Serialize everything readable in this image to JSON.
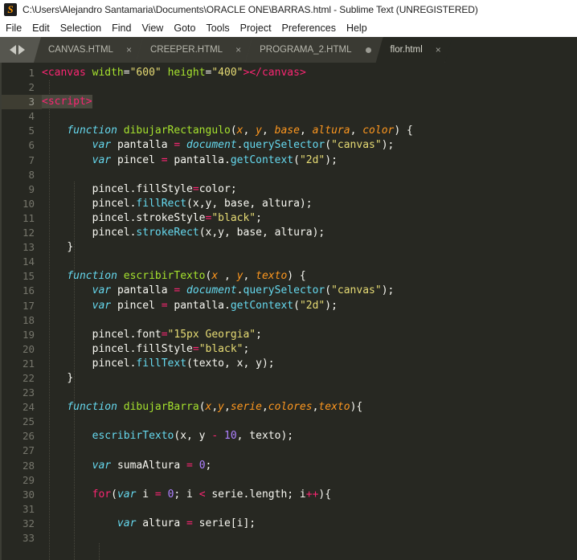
{
  "window": {
    "title": "C:\\Users\\Alejandro Santamaria\\Documents\\ORACLE ONE\\BARRAS.html - Sublime Text (UNREGISTERED)",
    "logo_glyph": "S",
    "logo_icon_name": "sublime-text-logo-icon"
  },
  "menubar": {
    "items": [
      {
        "label": "File"
      },
      {
        "label": "Edit"
      },
      {
        "label": "Selection"
      },
      {
        "label": "Find"
      },
      {
        "label": "View"
      },
      {
        "label": "Goto"
      },
      {
        "label": "Tools"
      },
      {
        "label": "Project"
      },
      {
        "label": "Preferences"
      },
      {
        "label": "Help"
      }
    ]
  },
  "tabbar": {
    "nav_prev_icon": "chevron-left-icon",
    "nav_next_icon": "chevron-right-icon",
    "close_glyph": "×",
    "tabs": [
      {
        "label": "CANVAS.HTML",
        "active": false,
        "dirty": false
      },
      {
        "label": "CREEPER.HTML",
        "active": false,
        "dirty": false
      },
      {
        "label": "PROGRAMA_2.HTML",
        "active": false,
        "dirty": true
      },
      {
        "label": "flor.html",
        "active": true,
        "dirty": false
      }
    ]
  },
  "editor": {
    "active_line": 3,
    "selection_text": "<script>",
    "line_numbers": [
      "1",
      "2",
      "3",
      "4",
      "5",
      "6",
      "7",
      "8",
      "9",
      "10",
      "11",
      "12",
      "13",
      "14",
      "15",
      "16",
      "17",
      "18",
      "19",
      "20",
      "21",
      "22",
      "23",
      "24",
      "25",
      "26",
      "27",
      "28",
      "29",
      "30",
      "31",
      "32",
      "33"
    ],
    "lines": [
      "<canvas width=\"600\" height=\"400\"></canvas>",
      "",
      "<script>",
      "",
      "    function dibujarRectangulo(x, y, base, altura, color) {",
      "        var pantalla = document.querySelector(\"canvas\");",
      "        var pincel = pantalla.getContext(\"2d\");",
      "",
      "        pincel.fillStyle=color;",
      "        pincel.fillRect(x,y, base, altura);",
      "        pincel.strokeStyle=\"black\";",
      "        pincel.strokeRect(x,y, base, altura);",
      "    }",
      "",
      "    function escribirTexto(x , y, texto) {",
      "        var pantalla = document.querySelector(\"canvas\");",
      "        var pincel = pantalla.getContext(\"2d\");",
      "",
      "        pincel.font=\"15px Georgia\";",
      "        pincel.fillStyle=\"black\";",
      "        pincel.fillText(texto, x, y);",
      "    }",
      "",
      "    function dibujarBarra(x,y,serie,colores,texto){",
      "",
      "        escribirTexto(x, y - 10, texto);",
      "",
      "        var sumaAltura = 0;",
      "",
      "        for(var i = 0; i < serie.length; i++){",
      "",
      "            var altura = serie[i];",
      ""
    ]
  },
  "colors": {
    "editor_background": "#272822",
    "titlebar_background": "#ffffff",
    "tabbar_background": "#56564f",
    "inactive_tab": "#3a3a33",
    "active_line_gutter": "#3e3d32",
    "selection": "#49483e",
    "accent_orange": "#ff9800",
    "token_tag": "#f92672",
    "token_string": "#e6db74",
    "token_keyword": "#66d9ef",
    "token_function": "#a6e22e",
    "token_param": "#fd971f",
    "token_number": "#ae81ff",
    "token_text": "#f8f8f2",
    "line_number": "#76766c"
  }
}
